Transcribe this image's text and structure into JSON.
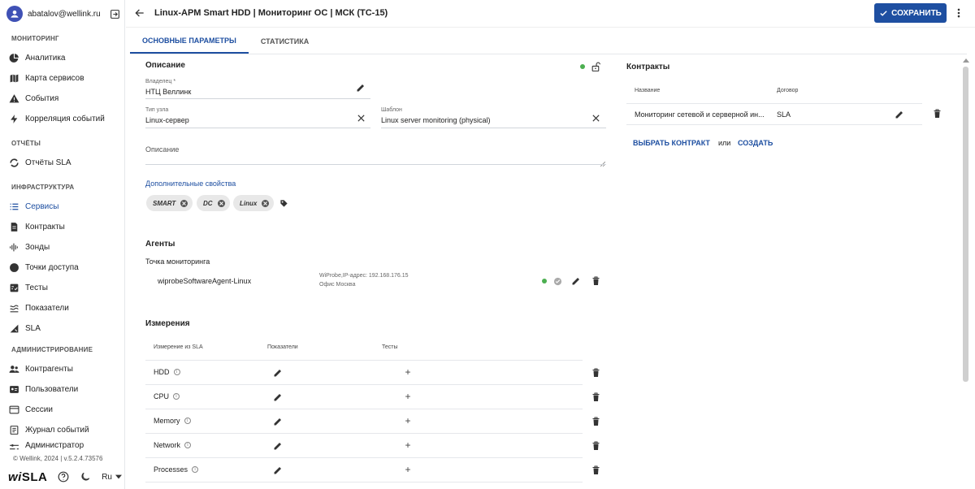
{
  "user": {
    "email": "abatalov@wellink.ru"
  },
  "sidebar": {
    "sections": [
      {
        "title": "МОНИТОРИНГ"
      },
      {
        "title": "ОТЧЁТЫ"
      },
      {
        "title": "ИНФРАСТРУКТУРА"
      },
      {
        "title": "АДМИНИСТРИРОВАНИЕ"
      }
    ],
    "items": [
      {
        "label": "Аналитика",
        "icon": "analytics-icon"
      },
      {
        "label": "Карта сервисов",
        "icon": "map-icon"
      },
      {
        "label": "События",
        "icon": "warning-icon"
      },
      {
        "label": "Корреляция событий",
        "icon": "bolt-icon"
      },
      {
        "label": "Отчёты SLA",
        "icon": "sync-icon"
      },
      {
        "label": "Сервисы",
        "icon": "list-icon"
      },
      {
        "label": "Контракты",
        "icon": "document-icon"
      },
      {
        "label": "Зонды",
        "icon": "probe-icon"
      },
      {
        "label": "Точки доступа",
        "icon": "circle-icon"
      },
      {
        "label": "Тесты",
        "icon": "tests-icon"
      },
      {
        "label": "Показатели",
        "icon": "metrics-icon"
      },
      {
        "label": "SLA",
        "icon": "sla-icon"
      },
      {
        "label": "Контрагенты",
        "icon": "people-icon"
      },
      {
        "label": "Пользователи",
        "icon": "user-card-icon"
      },
      {
        "label": "Сессии",
        "icon": "window-icon"
      },
      {
        "label": "Журнал событий",
        "icon": "journal-icon"
      },
      {
        "label": "Администратор",
        "icon": "settings-icon"
      }
    ],
    "footer": {
      "version": "© Wellink, 2024 | v.5.2.4.73576",
      "logo_w": "wi",
      "logo_rest": "SLA",
      "language": "Ru"
    }
  },
  "header": {
    "title": "Linux-APM Smart HDD | Мониторинг ОС | МСК (TC-15)",
    "save_label": "СОХРАНИТЬ"
  },
  "tabs": [
    {
      "label": "ОСНОВНЫЕ ПАРАМЕТРЫ",
      "active": true
    },
    {
      "label": "СТАТИСТИКА",
      "active": false
    }
  ],
  "description": {
    "heading": "Описание",
    "owner_label": "Владелец *",
    "owner_value": "НТЦ Веллинк",
    "node_type_label": "Тип узла",
    "node_type_value": "Linux-сервер",
    "template_label": "Шаблон",
    "template_value": "Linux server monitoring (physical)",
    "description_placeholder": "Описание",
    "extra_props_link": "Дополнительные свойства",
    "tags": [
      "SMART",
      "DC",
      "Linux"
    ],
    "status_color": "#4caf50"
  },
  "agents": {
    "heading": "Агенты",
    "point_label": "Точка мониторинга",
    "agent_name": "wiprobeSoftwareAgent-Linux",
    "agent_info": "WiProbe,IP-адрес: 192.168.176.15",
    "agent_location": "Офис Москва"
  },
  "measurements": {
    "heading": "Измерения",
    "columns": [
      "Измерение из SLA",
      "Показатели",
      "Тесты"
    ],
    "rows": [
      {
        "name": "HDD"
      },
      {
        "name": "CPU"
      },
      {
        "name": "Memory"
      },
      {
        "name": "Network"
      },
      {
        "name": "Processes"
      }
    ]
  },
  "contracts": {
    "heading": "Контракты",
    "columns": [
      "Название",
      "Договор"
    ],
    "rows": [
      {
        "name": "Мониторинг сетевой и серверной ин...",
        "contract": "SLA"
      }
    ],
    "choose_label": "ВЫБРАТЬ КОНТРАКТ",
    "or_label": "или",
    "create_label": "СОЗДАТЬ"
  },
  "colors": {
    "accent": "#1e4fa1",
    "status_green": "#4caf50"
  }
}
